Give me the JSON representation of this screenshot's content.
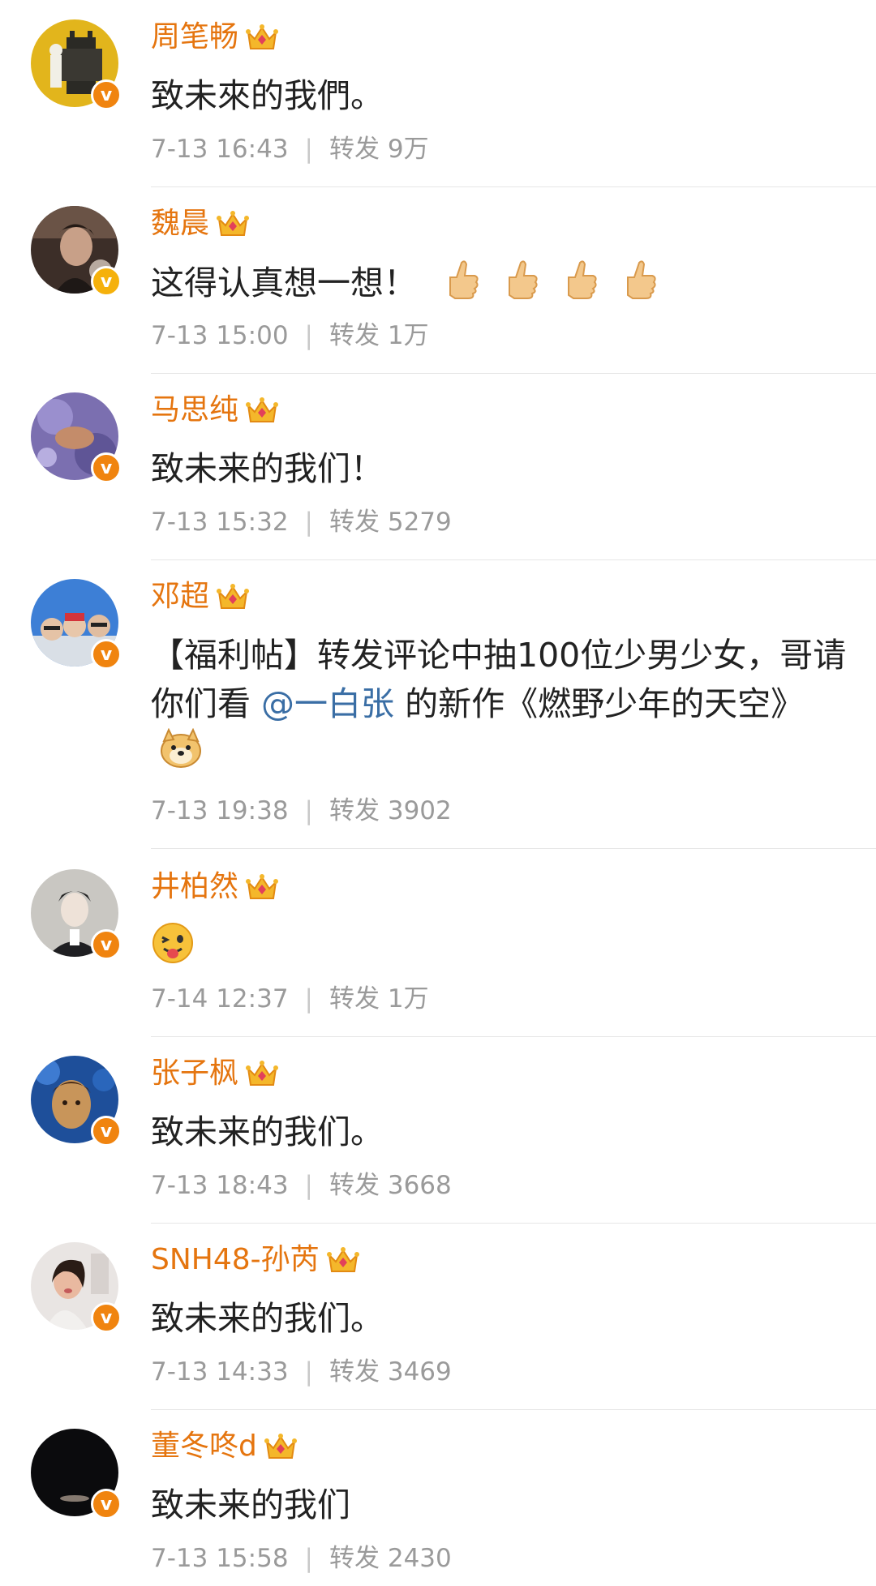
{
  "comments": [
    {
      "user": "周笔畅",
      "text": "致未來的我們。",
      "time": "7-13 16:43",
      "repost_label": "转发",
      "repost_count": "9万",
      "badge": "v"
    },
    {
      "user": "魏晨",
      "text": "这得认真想一想！",
      "emoji": "thumbs-up-icon x4",
      "time": "7-13 15:00",
      "repost_label": "转发",
      "repost_count": "1万",
      "badge": "v"
    },
    {
      "user": "马思纯",
      "text": "致未来的我们！",
      "time": "7-13 15:32",
      "repost_label": "转发",
      "repost_count": "5279",
      "badge": "v"
    },
    {
      "user": "邓超",
      "text_before": "【福利帖】转发评论中抽100位少男少女，哥请你们看",
      "mention": "@一白张",
      "text_after": " 的新作《燃野少年的天空》",
      "emoji": "doge-icon",
      "time": "7-13 19:38",
      "repost_label": "转发",
      "repost_count": "3902",
      "badge": "v"
    },
    {
      "user": "井柏然",
      "emoji": "tongue-face-icon",
      "time": "7-14 12:37",
      "repost_label": "转发",
      "repost_count": "1万",
      "badge": "v"
    },
    {
      "user": "张子枫",
      "text": "致未来的我们。",
      "time": "7-13 18:43",
      "repost_label": "转发",
      "repost_count": "3668",
      "badge": "v"
    },
    {
      "user": "SNH48-孙芮",
      "text": "致未来的我们。",
      "time": "7-13 14:33",
      "repost_label": "转发",
      "repost_count": "3469",
      "badge": "v"
    },
    {
      "user": "董冬咚d",
      "text": "致未来的我们",
      "time": "7-13 15:58",
      "repost_label": "转发",
      "repost_count": "2430",
      "badge": "v"
    }
  ],
  "colors": {
    "username": "#e5750f",
    "text": "#222222",
    "meta": "#9a9a9a",
    "mention": "#3a6ea5",
    "badge": "#f0840f"
  }
}
